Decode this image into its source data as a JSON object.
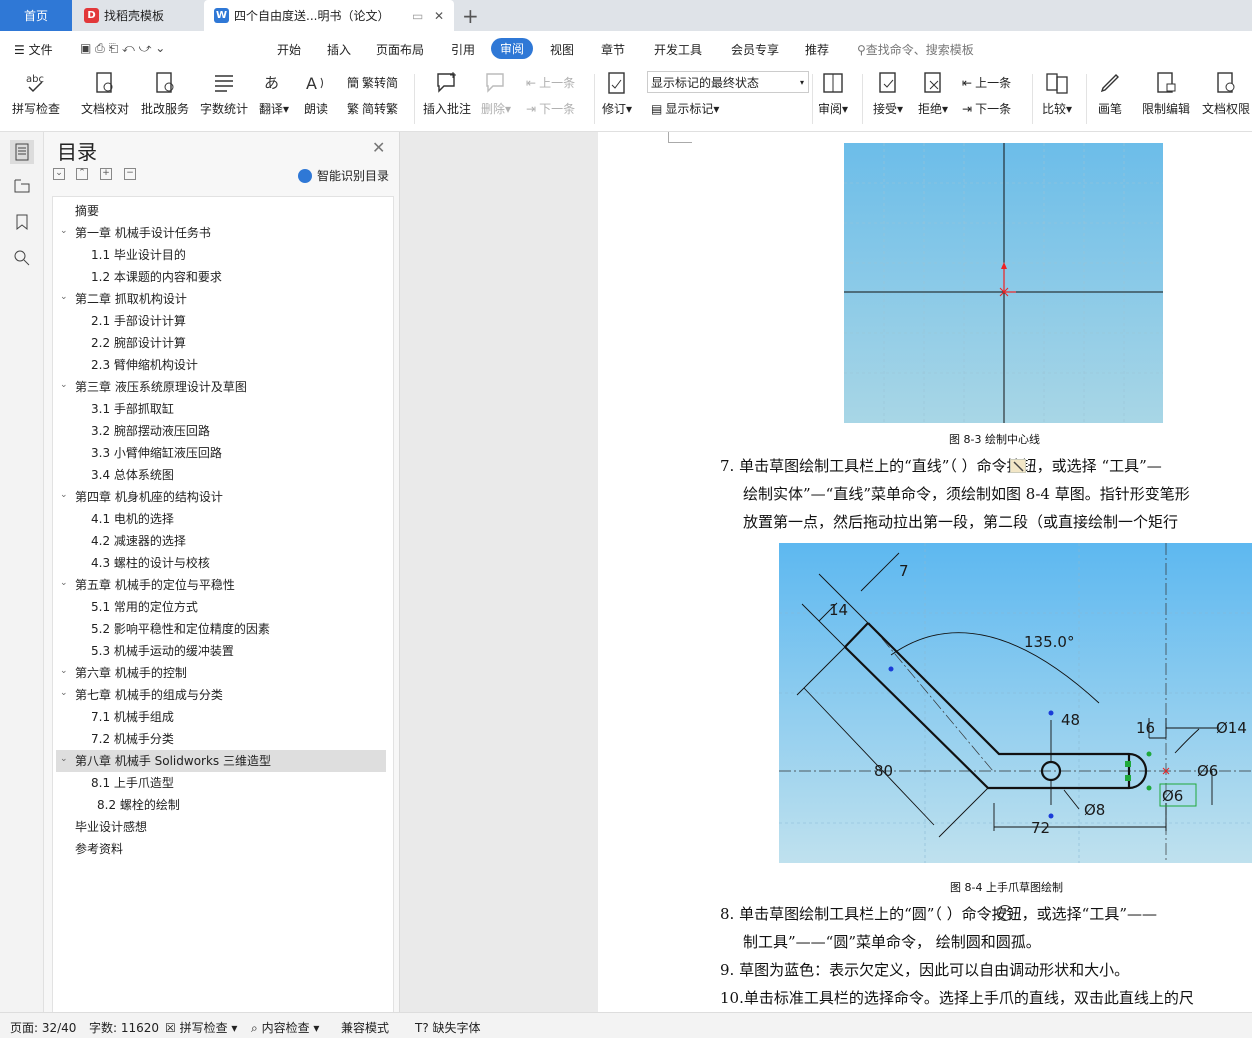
{
  "tabs": {
    "home": "首页",
    "template": "找稻壳模板",
    "doc": "四个自由度送...明书（论文）"
  },
  "menu": {
    "file": "文件",
    "items": [
      "开始",
      "插入",
      "页面布局",
      "引用",
      "审阅",
      "视图",
      "章节",
      "开发工具",
      "会员专享",
      "推荐"
    ],
    "search": "查找命令、搜索模板"
  },
  "ribbon": {
    "spell": "拼写检查",
    "proof": "文档校对",
    "batch": "批改服务",
    "wordcount": "字数统计",
    "translate": "翻译",
    "read": "朗读",
    "trad": "繁转简",
    "simp": "简转繁",
    "comment": "插入批注",
    "delete": "删除",
    "prev_c": "上一条",
    "next_c": "下一条",
    "revise": "修订",
    "markup_state": "显示标记的最终状态",
    "show_markup": "显示标记",
    "review": "审阅",
    "accept": "接受",
    "reject": "拒绝",
    "prev": "上一条",
    "next": "下一条",
    "compare": "比较",
    "pen": "画笔",
    "restrict": "限制编辑",
    "rights": "文档权限"
  },
  "toc": {
    "title": "目录",
    "smart": "智能识别目录",
    "items": [
      "摘要",
      "第一章  机械手设计任务书",
      "1.1 毕业设计目的",
      "1.2 本课题的内容和要求",
      "第二章  抓取机构设计",
      "2.1 手部设计计算",
      "2.2 腕部设计计算",
      "2.3 臂伸缩机构设计",
      "第三章  液压系统原理设计及草图",
      "3.1 手部抓取缸",
      "3.2 腕部摆动液压回路",
      "3.3 小臂伸缩缸液压回路",
      "3.4 总体系统图",
      "第四章  机身机座的结构设计",
      "4.1 电机的选择",
      "4.2 减速器的选择",
      "4.3 螺柱的设计与校核",
      "第五章  机械手的定位与平稳性",
      "5.1 常用的定位方式",
      "5.2 影响平稳性和定位精度的因素",
      "5.3 机械手运动的缓冲装置",
      "第六章  机械手的控制",
      "第七章  机械手的组成与分类",
      "7.1 机械手组成",
      "7.2 机械手分类",
      "第八章  机械手 Solidworks 三维造型",
      "8.1 上手爪造型",
      "8.2 螺栓的绘制",
      "毕业设计感想",
      "参考资料"
    ]
  },
  "doc": {
    "fig83": "图 8-3 绘制中心线",
    "p7a": "7.  单击草图绘制工具栏上的“直线”（   ）命令按钮，或选择 “工具”—",
    "p7b": "绘制实体”—“直线”菜单命令，须绘制如图 8-4 草图。指针形变笔形",
    "p7c": "放置第一点，然后拖动拉出第一段，第二段（或直接绘制一个矩行",
    "fig84": "图 8-4 上手爪草图绘制",
    "p8a": "8.  单击草图绘制工具栏上的“圆”（   ）命令按钮，或选择“工具”——",
    "p8b": "制工具”——“圆”菜单命令，  绘制圆和圆孤。",
    "p9": "9.  草图为蓝色：表示欠定义，因此可以自由调动形状和大小。",
    "p10": "10.单击标准工具栏的选择命令。选择上手爪的直线，双击此直线上的尺",
    "dims": {
      "d7": "7",
      "d14": "14",
      "ang": "135.0°",
      "d48": "48",
      "d16": "16",
      "dia14": "Ø14",
      "dia6a": "Ø6",
      "dia6b": "Ø6",
      "d80": "80",
      "dia8": "Ø8",
      "d72": "72"
    }
  },
  "status": {
    "page": "页面: 32/40",
    "words": "字数: 11620",
    "spell": "拼写检查",
    "content": "内容检查",
    "compat": "兼容模式",
    "font": "缺失字体"
  }
}
